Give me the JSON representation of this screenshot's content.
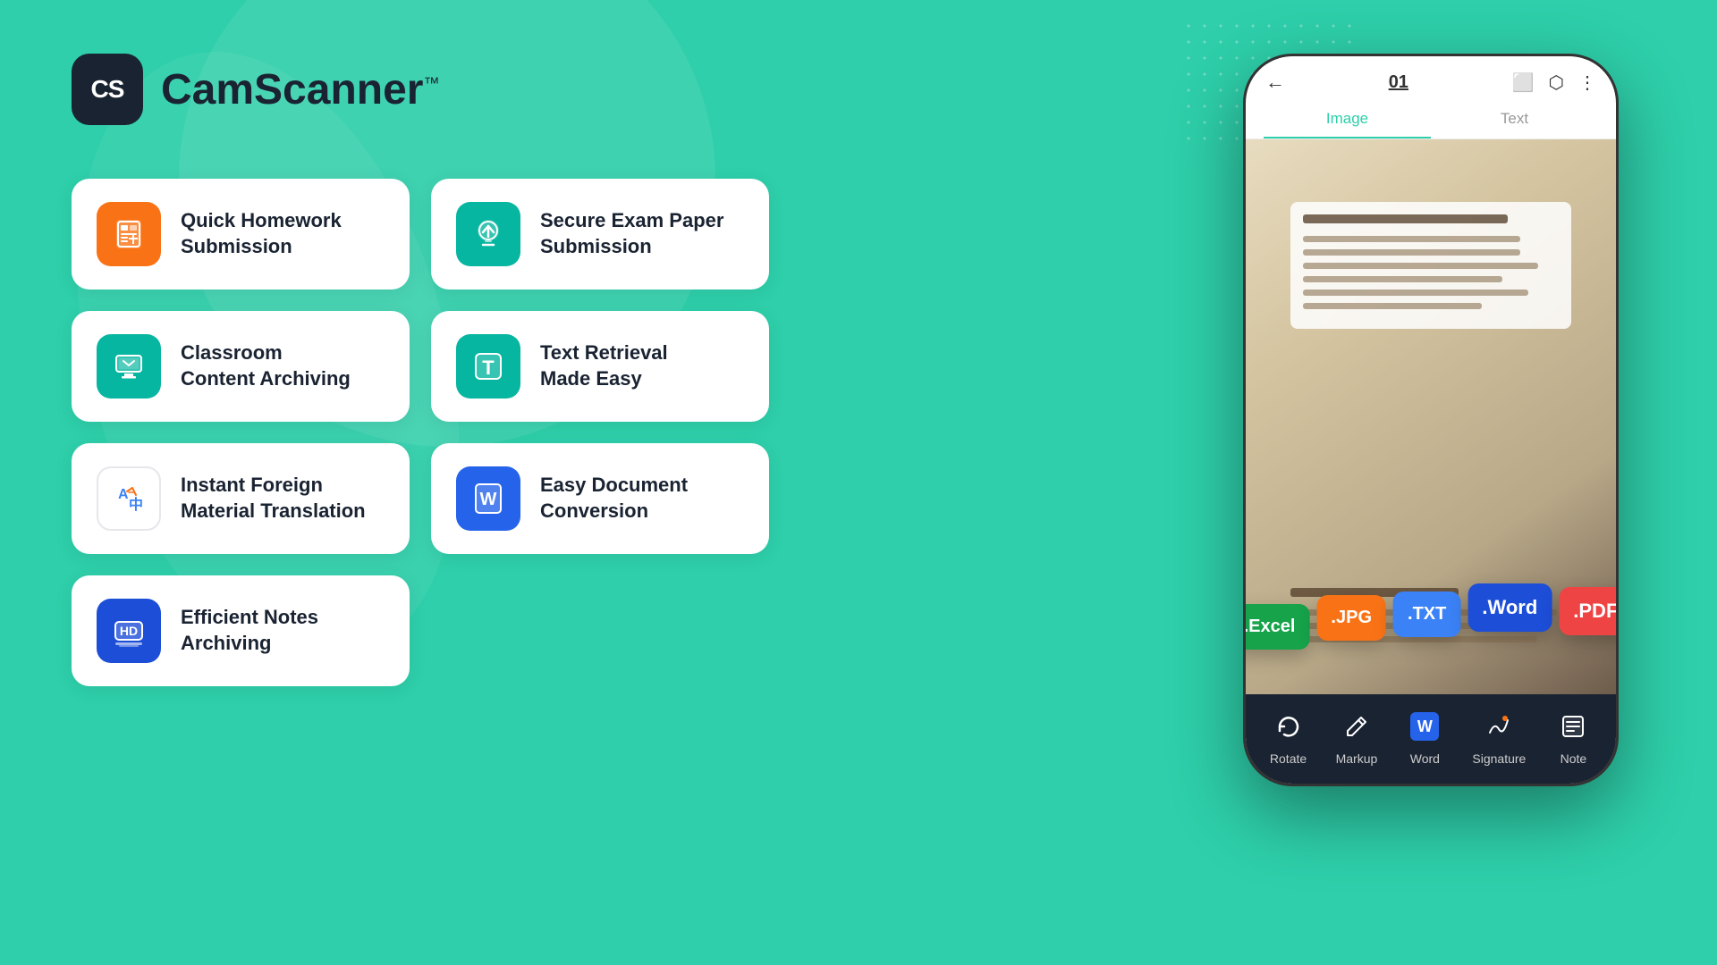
{
  "app": {
    "logo_letters": "CS",
    "logo_name": "CamScanner",
    "logo_tm": "™"
  },
  "features": [
    {
      "id": "quick-homework",
      "title": "Quick Homework\nSubmission",
      "icon_type": "orange-calc",
      "color": "orange"
    },
    {
      "id": "secure-exam",
      "title": "Secure Exam Paper\nSubmission",
      "icon_type": "teal-upload",
      "color": "teal"
    },
    {
      "id": "classroom-archiving",
      "title": "Classroom\nContent Archiving",
      "icon_type": "blue-monitor",
      "color": "blue-light"
    },
    {
      "id": "text-retrieval",
      "title": "Text Retrieval\nMade Easy",
      "icon_type": "teal-T",
      "color": "teal"
    },
    {
      "id": "foreign-translation",
      "title": "Instant Foreign\nMaterial Translation",
      "icon_type": "translate",
      "color": "translate"
    },
    {
      "id": "easy-conversion",
      "title": "Easy Document\nConversion",
      "icon_type": "word-blue",
      "color": "word-blue"
    },
    {
      "id": "notes-archiving",
      "title": "Efficient Notes\nArchiving",
      "icon_type": "hd-blue",
      "color": "hd-blue"
    }
  ],
  "phone": {
    "title": "01",
    "tab_image": "Image",
    "tab_text": "Text"
  },
  "formats": [
    {
      "label": ".Excel",
      "class": "excel"
    },
    {
      "label": ".JPG",
      "class": "jpg"
    },
    {
      "label": ".TXT",
      "class": "txt"
    },
    {
      "label": ".Word",
      "class": "word"
    },
    {
      "label": ".PDF",
      "class": "pdf"
    }
  ],
  "toolbar": [
    {
      "label": "Rotate",
      "icon": "↻"
    },
    {
      "label": "Markup",
      "icon": "✏"
    },
    {
      "label": "Word",
      "icon": "W"
    },
    {
      "label": "Signature",
      "icon": "✍"
    },
    {
      "label": "Note",
      "icon": "☰"
    }
  ]
}
